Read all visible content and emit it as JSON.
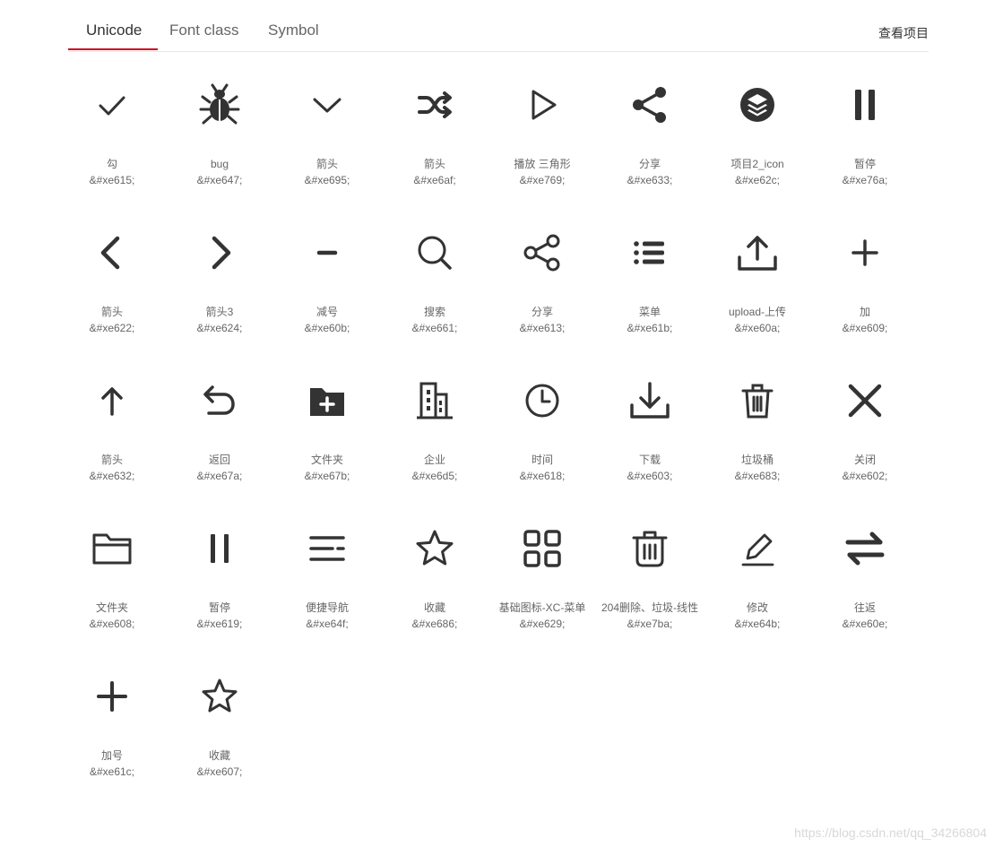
{
  "tabs": [
    {
      "label": "Unicode",
      "active": true
    },
    {
      "label": "Font class",
      "active": false
    },
    {
      "label": "Symbol",
      "active": false
    }
  ],
  "header": {
    "view_project": "查看项目"
  },
  "accent_color": "#d0021b",
  "icon_color": "#333333",
  "icons": [
    {
      "icon": "check-icon",
      "name": "勾",
      "code": "&#xe615;"
    },
    {
      "icon": "bug-icon",
      "name": "bug",
      "code": "&#xe647;"
    },
    {
      "icon": "chevron-down-icon",
      "name": "箭头",
      "code": "&#xe695;"
    },
    {
      "icon": "shuffle-icon",
      "name": "箭头",
      "code": "&#xe6af;"
    },
    {
      "icon": "play-triangle-icon",
      "name": "播放 三角形",
      "code": "&#xe769;"
    },
    {
      "icon": "share-icon",
      "name": "分享",
      "code": "&#xe633;"
    },
    {
      "icon": "layers-icon",
      "name": "项目2_icon",
      "code": "&#xe62c;"
    },
    {
      "icon": "pause-icon",
      "name": "暂停",
      "code": "&#xe76a;"
    },
    {
      "icon": "chevron-left-icon",
      "name": "箭头",
      "code": "&#xe622;"
    },
    {
      "icon": "chevron-right-icon",
      "name": "箭头3",
      "code": "&#xe624;"
    },
    {
      "icon": "minus-icon",
      "name": "减号",
      "code": "&#xe60b;"
    },
    {
      "icon": "search-icon",
      "name": "搜索",
      "code": "&#xe661;"
    },
    {
      "icon": "share-outline-icon",
      "name": "分享",
      "code": "&#xe613;"
    },
    {
      "icon": "list-icon",
      "name": "菜单",
      "code": "&#xe61b;"
    },
    {
      "icon": "upload-icon",
      "name": "upload-上传",
      "code": "&#xe60a;"
    },
    {
      "icon": "plus-icon",
      "name": "加",
      "code": "&#xe609;"
    },
    {
      "icon": "arrow-up-icon",
      "name": "箭头",
      "code": "&#xe632;"
    },
    {
      "icon": "undo-icon",
      "name": "返回",
      "code": "&#xe67a;"
    },
    {
      "icon": "folder-add-icon",
      "name": "文件夹",
      "code": "&#xe67b;"
    },
    {
      "icon": "building-icon",
      "name": "企业",
      "code": "&#xe6d5;"
    },
    {
      "icon": "clock-icon",
      "name": "时间",
      "code": "&#xe618;"
    },
    {
      "icon": "download-icon",
      "name": "下载",
      "code": "&#xe603;"
    },
    {
      "icon": "trash-icon",
      "name": "垃圾桶",
      "code": "&#xe683;"
    },
    {
      "icon": "close-icon",
      "name": "关闭",
      "code": "&#xe602;"
    },
    {
      "icon": "folder-icon",
      "name": "文件夹",
      "code": "&#xe608;"
    },
    {
      "icon": "pause-thin-icon",
      "name": "暂停",
      "code": "&#xe619;"
    },
    {
      "icon": "menu-lines-icon",
      "name": "便捷导航",
      "code": "&#xe64f;"
    },
    {
      "icon": "star-icon",
      "name": "收藏",
      "code": "&#xe686;"
    },
    {
      "icon": "grid-icon",
      "name": "基础图标-XC-菜单",
      "code": "&#xe629;"
    },
    {
      "icon": "trash-outline-icon",
      "name": "204删除、垃圾-线性",
      "code": "&#xe7ba;"
    },
    {
      "icon": "edit-icon",
      "name": "修改",
      "code": "&#xe64b;"
    },
    {
      "icon": "swap-icon",
      "name": "往返",
      "code": "&#xe60e;"
    },
    {
      "icon": "plus-bold-icon",
      "name": "加号",
      "code": "&#xe61c;"
    },
    {
      "icon": "star-outline-icon",
      "name": "收藏",
      "code": "&#xe607;"
    }
  ],
  "watermark": "https://blog.csdn.net/qq_34266804"
}
